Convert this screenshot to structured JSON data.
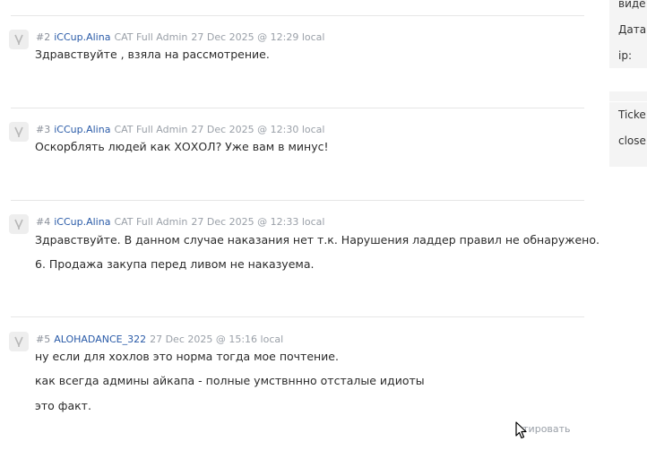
{
  "posts": [
    {
      "num": "#2",
      "author": "iCCup.Alina",
      "role": "CAT Full Admin",
      "date": "27 Dec 2025 @ 12:29 local",
      "lines": [
        "Здравствуйте , взяла на рассмотрение."
      ]
    },
    {
      "num": "#3",
      "author": "iCCup.Alina",
      "role": "CAT Full Admin",
      "date": "27 Dec 2025 @ 12:30 local",
      "lines": [
        "Оскорблять людей как ХОХОЛ? Уже вам в минус!"
      ]
    },
    {
      "num": "#4",
      "author": "iCCup.Alina",
      "role": "CAT Full Admin",
      "date": "27 Dec 2025 @ 12:33 local",
      "lines": [
        "Здравствуйте. В данном случае наказания нет т.к. Нарушения ладдер правил не обнаружено.",
        "6. Продажа закупа перед ливом не наказуема."
      ]
    },
    {
      "num": "#5",
      "author": "ALOHADANCE_322",
      "role": "",
      "date": "27 Dec 2025 @ 15:16 local",
      "lines": [
        "ну если для хохлов это норма тогда мое почтение.",
        "как всегда админы айкапа - полные умствнннo отсталые идиоты",
        "это факт."
      ]
    }
  ],
  "quote_label": "итировать",
  "sidebar": {
    "info_labels": [
      "виде",
      "Дата",
      "ip:"
    ],
    "ticket_labels": [
      "Ticke",
      "close"
    ]
  }
}
